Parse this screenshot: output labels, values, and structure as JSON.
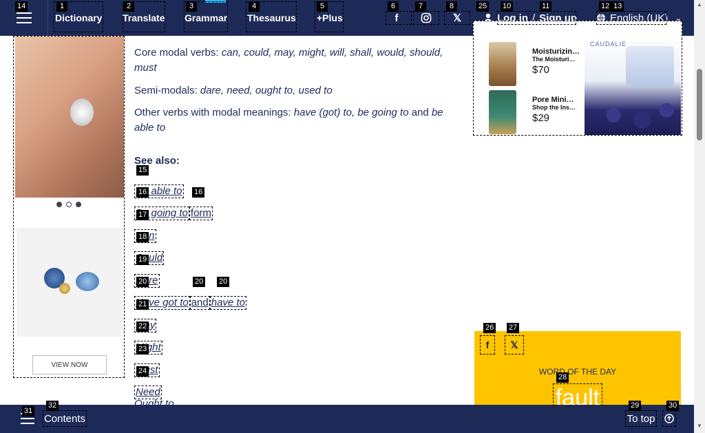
{
  "nav": {
    "items": [
      "Dictionary",
      "Translate",
      "Grammar",
      "Thesaurus",
      "+Plus"
    ],
    "login": "Log in",
    "slash": "/",
    "signup": "Sign up",
    "language": "English (UK)"
  },
  "content": {
    "core_label": "Core modal verbs:",
    "core_verbs": "can, could, may, might, will, shall, would, should, must",
    "semi_label": "Semi-modals:",
    "semi_verbs": "dare, need, ought to, used to",
    "other_label": "Other verbs with modal meanings:",
    "other_verbs_1": "have (got) to, be going to",
    "and": "and",
    "other_verbs_2": "be able to",
    "see_also": "See also:",
    "links": [
      "Be able to",
      "Be going to",
      "form",
      "Can",
      "Could",
      "Dare",
      "Have got to",
      "and",
      "have to",
      "May",
      "Might",
      "Must",
      "Need"
    ],
    "peek": "Ought to"
  },
  "left_ad": {
    "cta": "VIEW NOW"
  },
  "right_ad": {
    "brand": "CAUDALIE",
    "products": [
      {
        "title": "Moisturizin…",
        "subtitle": "The Moisturi…",
        "price": "$70"
      },
      {
        "title": "Pore Mini…",
        "subtitle": "Shop the Ins…",
        "price": "$29"
      }
    ]
  },
  "wotd": {
    "label": "WORD OF THE DAY",
    "word": "fault"
  },
  "bottom": {
    "contents": "Contents",
    "to_top": "To top"
  },
  "tags": [
    "14",
    "1",
    "2",
    "3",
    "4",
    "5",
    "6",
    "7",
    "8",
    "25",
    "10",
    "11",
    "12",
    "13",
    "15",
    "16",
    "16",
    "17",
    "18",
    "19",
    "20",
    "20",
    "20",
    "21",
    "22",
    "23",
    "24",
    "26",
    "27",
    "28",
    "29",
    "30",
    "31",
    "32"
  ]
}
